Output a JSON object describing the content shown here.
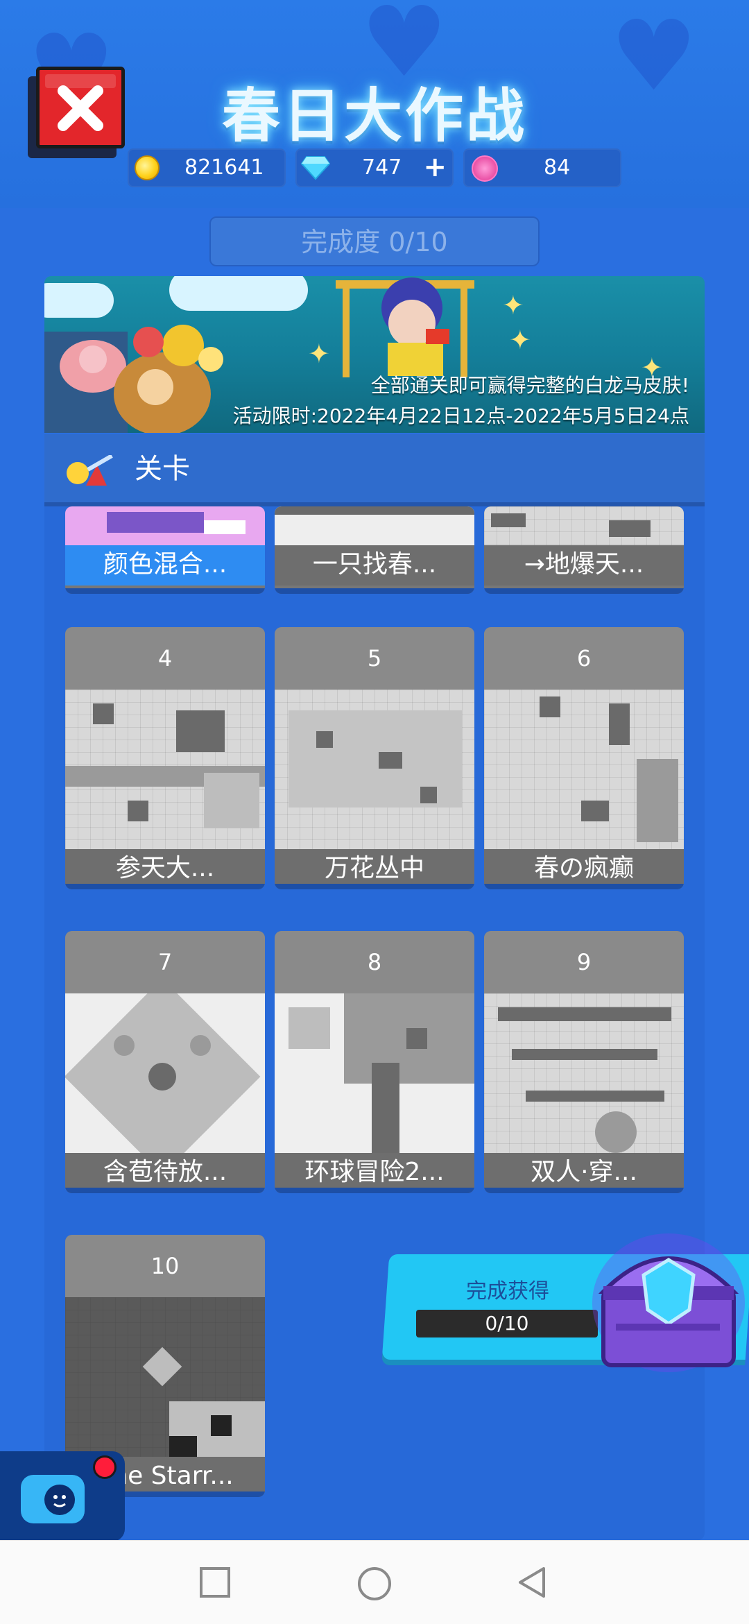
{
  "header": {
    "title": "春日大作战",
    "resources": {
      "coins": "821641",
      "gems": "747",
      "gems_add": "+",
      "lotus": "84"
    },
    "progress": "完成度 0/10"
  },
  "banner": {
    "line1": "全部通关即可赢得完整的白龙马皮肤!",
    "line2": "活动限时:2022年4月22日12点-2022年5月5日24点"
  },
  "section": {
    "title": "关卡"
  },
  "levels": [
    {
      "num": "",
      "name": "颜色混合..."
    },
    {
      "num": "",
      "name": "一只找春..."
    },
    {
      "num": "",
      "name": "→地爆天..."
    },
    {
      "num": "4",
      "name": "参天大..."
    },
    {
      "num": "5",
      "name": "万花丛中"
    },
    {
      "num": "6",
      "name": "春の疯癫"
    },
    {
      "num": "7",
      "name": "含苞待放..."
    },
    {
      "num": "8",
      "name": "环球冒险2..."
    },
    {
      "num": "9",
      "name": "双人·穿..."
    },
    {
      "num": "10",
      "name": "The Starr..."
    }
  ],
  "reward": {
    "label": "完成获得",
    "progress": "0/10"
  },
  "colors": {
    "background": "#2a6fe0",
    "accent_cyan": "#22c7f4",
    "close_red": "#e3262b"
  },
  "icons": {
    "close": "close-x-icon",
    "coin": "coin-icon",
    "gem": "diamond-icon",
    "lotus": "lotus-icon",
    "section": "level-icon",
    "chest": "treasure-chest-icon",
    "assistant": "assistant-icon",
    "nav_recent": "square-icon",
    "nav_home": "circle-icon",
    "nav_back": "triangle-back-icon"
  }
}
